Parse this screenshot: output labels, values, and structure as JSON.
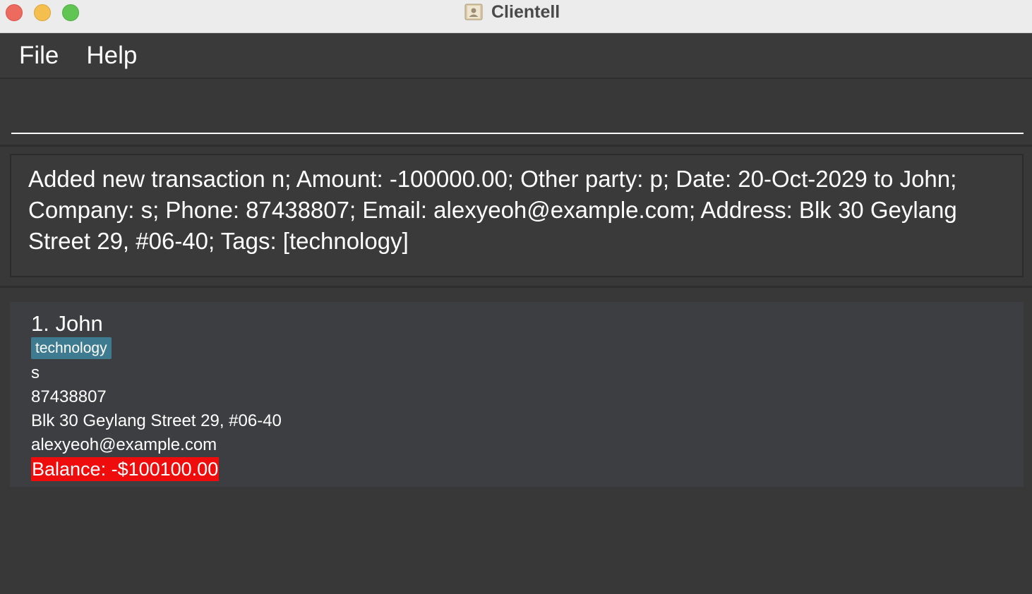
{
  "window": {
    "title": "Clientell"
  },
  "menubar": {
    "file_label": "File",
    "help_label": "Help"
  },
  "command": {
    "value": "",
    "placeholder": ""
  },
  "result": {
    "message": "Added new transaction n; Amount: -100000.00; Other party: p; Date: 20-Oct-2029 to John; Company: s; Phone: 87438807; Email: alexyeoh@example.com; Address: Blk 30 Geylang Street 29, #06-40; Tags: [technology]"
  },
  "persons": [
    {
      "name": "1. John",
      "tags": [
        "technology"
      ],
      "company": "s",
      "phone": "87438807",
      "address": "Blk 30 Geylang Street 29, #06-40",
      "email": "alexyeoh@example.com",
      "balance": "Balance: -$100100.00"
    }
  ],
  "colors": {
    "background": "#383838",
    "card": "#3d3e41",
    "tag": "#3e7b91",
    "balance_negative": "#ee0c0c"
  },
  "icons": {
    "close": "close-icon",
    "minimize": "minimize-icon",
    "maximize": "maximize-icon",
    "app": "contacts-app-icon"
  }
}
